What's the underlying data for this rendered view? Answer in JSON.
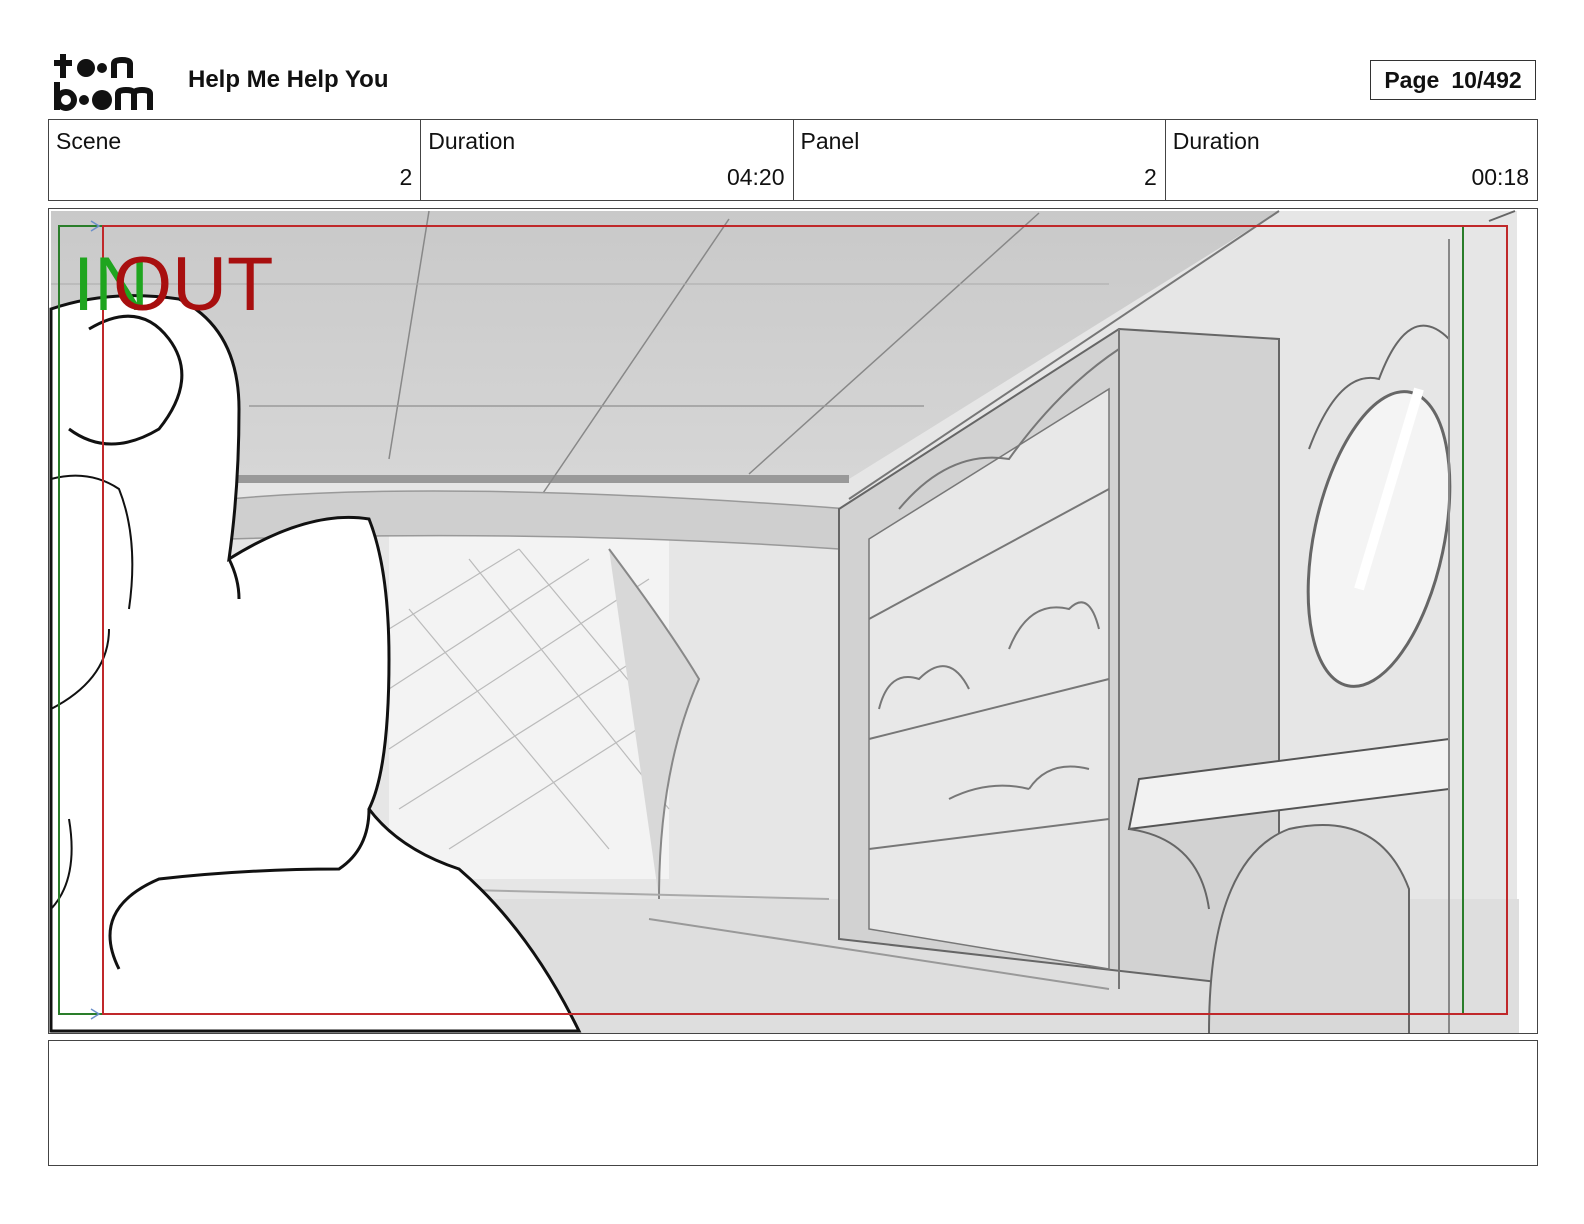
{
  "header": {
    "logo_name": "toonboom-logo",
    "project_title": "Help Me Help You",
    "page_label": "Page",
    "page_number": "10/492"
  },
  "info": [
    {
      "label": "Scene",
      "value": "2"
    },
    {
      "label": "Duration",
      "value": "04:20"
    },
    {
      "label": "Panel",
      "value": "2"
    },
    {
      "label": "Duration",
      "value": "00:18"
    }
  ],
  "panel": {
    "in_marker": "IN",
    "out_marker": "OUT",
    "in_color": "#1fa51f",
    "out_color": "#a80f0f",
    "safe_frame_color": "#c0282a",
    "in_frame_color": "#2a7d2a"
  },
  "notes": {
    "text": ""
  }
}
